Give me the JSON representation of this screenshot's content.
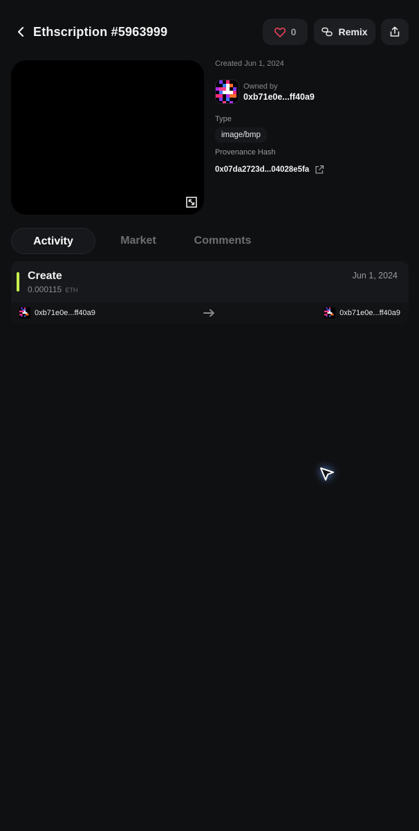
{
  "header": {
    "title": "Ethscription #5963999",
    "like_count": "0",
    "remix_label": "Remix"
  },
  "info": {
    "created": "Created Jun 1, 2024",
    "owned_by_label": "Owned by",
    "owner_address": "0xb71e0e...ff40a9",
    "type_label": "Type",
    "type_value": "image/bmp",
    "provenance_label": "Provenance Hash",
    "provenance_hash": "0x07da2723d...04028e5fa"
  },
  "tabs": [
    {
      "label": "Activity",
      "active": true
    },
    {
      "label": "Market",
      "active": false
    },
    {
      "label": "Comments",
      "active": false
    }
  ],
  "activity": [
    {
      "event": "Create",
      "amount": "0.000115",
      "unit": "ETH",
      "date": "Jun 1, 2024",
      "from": "0xb71e0e...ff40a9",
      "to": "0xb71e0e...ff40a9"
    }
  ],
  "colors": {
    "background": "#0f1012",
    "card": "#17181b",
    "accent": "#c8f04c",
    "like_heart": "#e0405a"
  },
  "icons": [
    "back-arrow-icon",
    "heart-icon",
    "remix-link-icon",
    "share-icon",
    "expand-icon",
    "external-link-icon",
    "arrow-right-icon"
  ]
}
